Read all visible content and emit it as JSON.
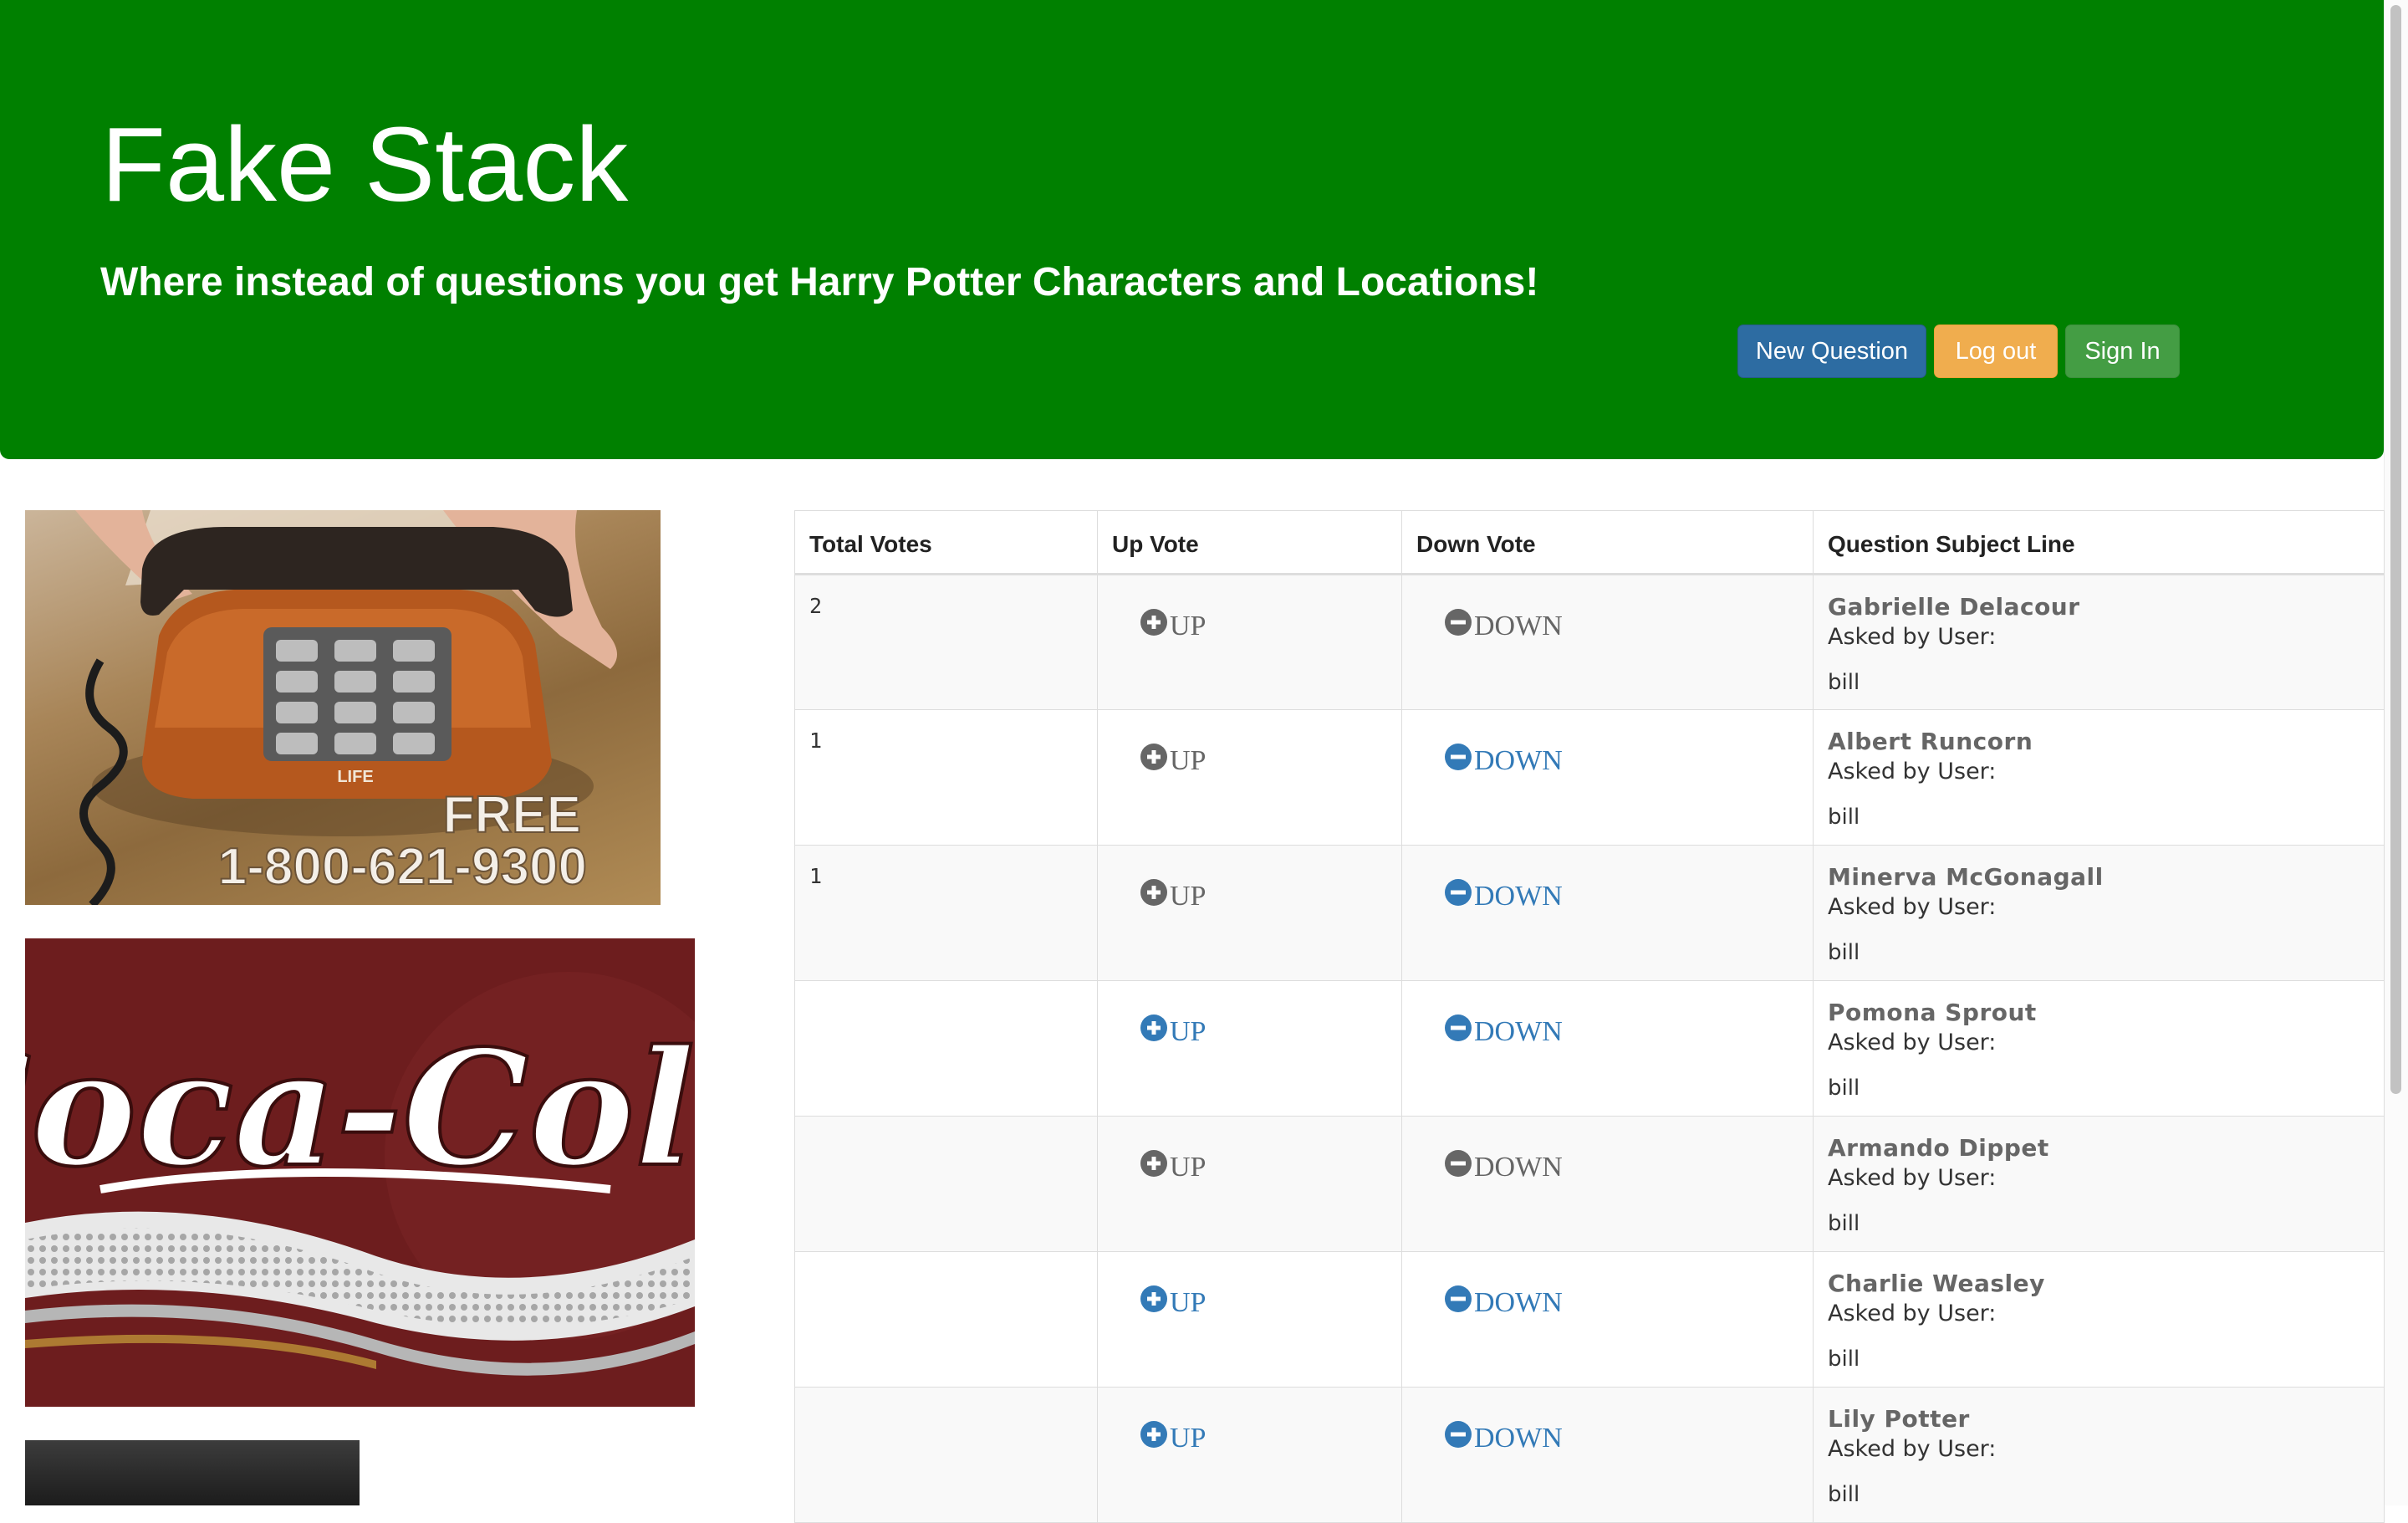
{
  "header": {
    "title": "Fake Stack",
    "subtitle": "Where instead of questions you get Harry Potter Characters and Locations!",
    "buttons": {
      "new_question": "New Question",
      "log_out": "Log out",
      "sign_in": "Sign In"
    },
    "background_color": "#008000"
  },
  "ads": {
    "phone": {
      "line1": "FREE",
      "line2": "1-800-621-9300",
      "brand": "LIFE"
    },
    "coke": {
      "logo_text": "Coca-Cola"
    }
  },
  "table": {
    "columns": [
      "Total Votes",
      "Up Vote",
      "Down Vote",
      "Question Subject Line"
    ],
    "up_label": "UP",
    "down_label": "DOWN",
    "asked_label": "Asked by User:",
    "rows": [
      {
        "votes": "2",
        "up_active": false,
        "down_active": false,
        "subject": "Gabrielle Delacour",
        "user": "bill"
      },
      {
        "votes": "1",
        "up_active": false,
        "down_active": true,
        "subject": "Albert Runcorn",
        "user": "bill"
      },
      {
        "votes": "1",
        "up_active": false,
        "down_active": true,
        "subject": "Minerva McGonagall",
        "user": "bill"
      },
      {
        "votes": "",
        "up_active": true,
        "down_active": true,
        "subject": "Pomona Sprout",
        "user": "bill"
      },
      {
        "votes": "",
        "up_active": false,
        "down_active": false,
        "subject": "Armando Dippet",
        "user": "bill"
      },
      {
        "votes": "",
        "up_active": true,
        "down_active": true,
        "subject": "Charlie Weasley",
        "user": "bill"
      },
      {
        "votes": "",
        "up_active": true,
        "down_active": true,
        "subject": "Lily Potter",
        "user": "bill"
      }
    ]
  },
  "colors": {
    "link_blue": "#337ab7",
    "link_gray": "#666666",
    "btn_primary": "#2d6ca2",
    "btn_warning": "#f0ad4e",
    "btn_success": "#449d44"
  }
}
